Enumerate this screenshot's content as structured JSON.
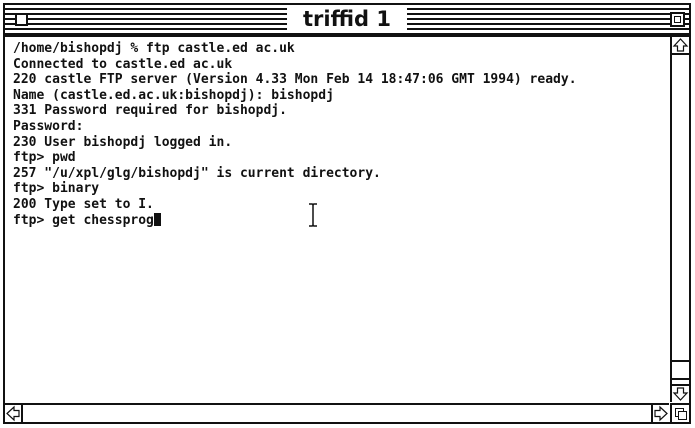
{
  "window": {
    "title": "triffid 1"
  },
  "terminal": {
    "lines": [
      "/home/bishopdj % ftp castle.ed ac.uk",
      "Connected to castle.ed ac.uk",
      "220 castle FTP server (Version 4.33 Mon Feb 14 18:47:06 GMT 1994) ready.",
      "Name (castle.ed.ac.uk:bishopdj): bishopdj",
      "331 Password required for bishopdj.",
      "Password:",
      "230 User bishopdj logged in.",
      "ftp> pwd",
      "257 \"/u/xpl/glg/bishopdj\" is current directory.",
      "ftp> binary",
      "200 Type set to I.",
      "ftp> get chessprog"
    ]
  },
  "icons": {
    "close": "close-box-icon",
    "zoom": "zoom-box-icon",
    "cursor": "i-beam-cursor-icon",
    "scroll_up": "arrow-up-icon",
    "scroll_down": "arrow-down-icon",
    "scroll_left": "arrow-left-icon",
    "scroll_right": "arrow-right-icon",
    "grow": "resize-grow-icon"
  }
}
